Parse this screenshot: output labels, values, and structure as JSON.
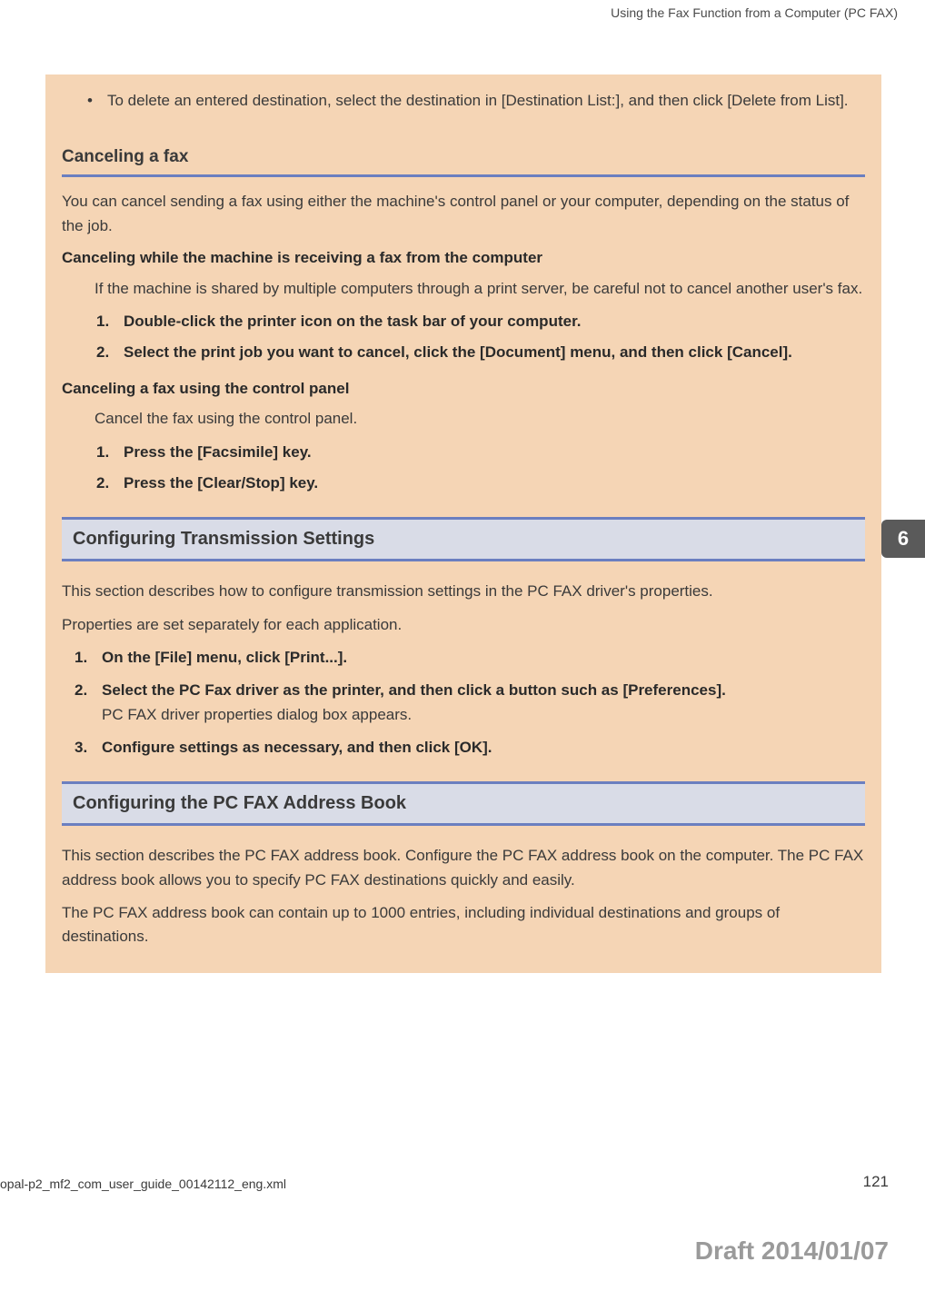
{
  "header": {
    "title": "Using the Fax Function from a Computer (PC FAX)"
  },
  "bullet1": {
    "text": "To delete an entered destination, select the destination in [Destination List:], and then click [Delete from List]."
  },
  "cancel": {
    "heading": "Canceling a fax",
    "intro": "You can cancel sending a fax using either the machine's control panel or your computer, depending on the status of the job.",
    "sub1_title": "Canceling while the machine is receiving a fax from the computer",
    "sub1_p": "If the machine is shared by multiple computers through a print server, be careful not to cancel another user's fax.",
    "sub1_steps": [
      "Double-click the printer icon on the task bar of your computer.",
      "Select the print job you want to cancel, click the [Document] menu, and then click [Cancel]."
    ],
    "sub2_title": "Canceling a fax using the control panel",
    "sub2_p": "Cancel the fax using the control panel.",
    "sub2_steps": [
      "Press the [Facsimile] key.",
      "Press the [Clear/Stop] key."
    ]
  },
  "trans": {
    "heading": "Configuring Transmission Settings",
    "p1": "This section describes how to configure transmission settings in the PC FAX driver's properties.",
    "p2": "Properties are set separately for each application.",
    "steps": [
      {
        "bold": "On the [File] menu, click [Print...].",
        "normal": ""
      },
      {
        "bold": "Select the PC Fax driver as the printer, and then click a button such as [Preferences].",
        "normal": "PC FAX driver properties dialog box appears."
      },
      {
        "bold": "Configure settings as necessary, and then click [OK].",
        "normal": ""
      }
    ]
  },
  "addrbook": {
    "heading": "Configuring the PC FAX Address Book",
    "p1": "This section describes the PC FAX address book. Configure the PC FAX address book on the computer. The PC FAX address book allows you to specify PC FAX destinations quickly and easily.",
    "p2": "The PC FAX address book can contain up to 1000 entries, including individual destinations and groups of destinations."
  },
  "chapter_tab": "6",
  "footer": {
    "left": "opal-p2_mf2_com_user_guide_00142112_eng.xml",
    "right": "121",
    "draft": "Draft 2014/01/07"
  }
}
